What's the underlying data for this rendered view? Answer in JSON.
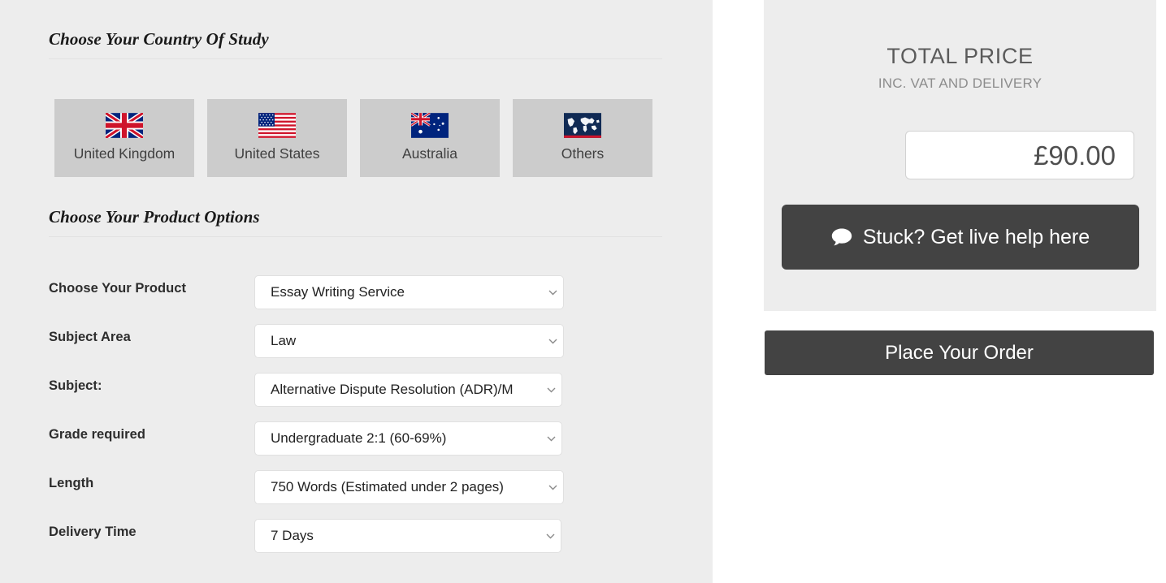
{
  "country_section": {
    "heading": "Choose Your Country Of Study",
    "tiles": [
      {
        "label": "United Kingdom",
        "icon": "flag-united-kingdom-icon"
      },
      {
        "label": "United States",
        "icon": "flag-united-states-icon"
      },
      {
        "label": "Australia",
        "icon": "flag-australia-icon"
      },
      {
        "label": "Others",
        "icon": "globe-world-map-icon"
      }
    ]
  },
  "product_section": {
    "heading": "Choose Your Product Options",
    "fields": [
      {
        "label": "Choose Your Product",
        "value": "Essay Writing Service"
      },
      {
        "label": "Subject Area",
        "value": "Law"
      },
      {
        "label": "Subject:",
        "value": "Alternative Dispute Resolution (ADR)/M"
      },
      {
        "label": "Grade required",
        "value": "Undergraduate 2:1 (60-69%)"
      },
      {
        "label": "Length",
        "value": "750 Words (Estimated under 2 pages)"
      },
      {
        "label": "Delivery Time",
        "value": "7 Days"
      }
    ]
  },
  "summary": {
    "title": "TOTAL PRICE",
    "subtitle": "INC. VAT AND DELIVERY",
    "price": "£90.00",
    "live_help_label": "Stuck? Get live help here",
    "live_help_icon": "chat-bubble-icon",
    "place_order_label": "Place Your Order"
  },
  "colors": {
    "panel_background": "#ededed",
    "tile_background": "#cccccc",
    "button_dark": "#434343",
    "field_white": "#ffffff",
    "page_background": "#ffffff"
  }
}
